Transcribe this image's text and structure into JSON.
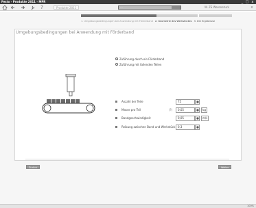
{
  "window": {
    "title": "Festo - Produkte 2011 - MPR",
    "minimize": "_",
    "maximize": "□",
    "close": "x"
  },
  "toolbar": {
    "back_icon": "back-arrow-icon",
    "forward_icon": "forward-arrow-icon",
    "tools_icon": "tools-icon",
    "help_icon": "help-icon",
    "product_label": "Produkte 2011",
    "progress_label": "...",
    "progress_fraction": 0.85,
    "wizard_label": "W. ZS Wareneturk",
    "close_icon": "close-icon",
    "close_label": "x"
  },
  "steps": {
    "items": [
      {
        "label": "1. Umgebungsbedingungen bei Anwendung mit Förderband",
        "state": "done"
      },
      {
        "label": "2. Geometrie des Werkstückes",
        "state": "active"
      },
      {
        "label": "3. Die Ergebnisse",
        "state": "future"
      }
    ]
  },
  "page": {
    "heading": "Umgebungsbedingungen bei Anwendung mit Förderband"
  },
  "options": {
    "radio1": "Zuführung durch ein Förderband",
    "radio2": "Zuführung mit fallenden Teilen"
  },
  "params": {
    "anzahl": {
      "label": "Anzahl der Teile",
      "value": "75"
    },
    "masse": {
      "label": "Masse pro Teil",
      "qmark": "(?)",
      "value": "0,05",
      "unit": "kg"
    },
    "band": {
      "label": "Bandgeschwindigkeit",
      "value": "0,05",
      "unit": "m/s"
    },
    "reibung": {
      "label": "Reibung zwischen Band und Werkstück",
      "value": "0,3"
    }
  },
  "footer": {
    "back_label": "Zurück",
    "next_label": "Weiter"
  },
  "status": {
    "zoom": "100%"
  },
  "colors": {
    "titlebar": "#3a3a3a",
    "belt": "#333333",
    "parts": "#6a6a6a"
  }
}
